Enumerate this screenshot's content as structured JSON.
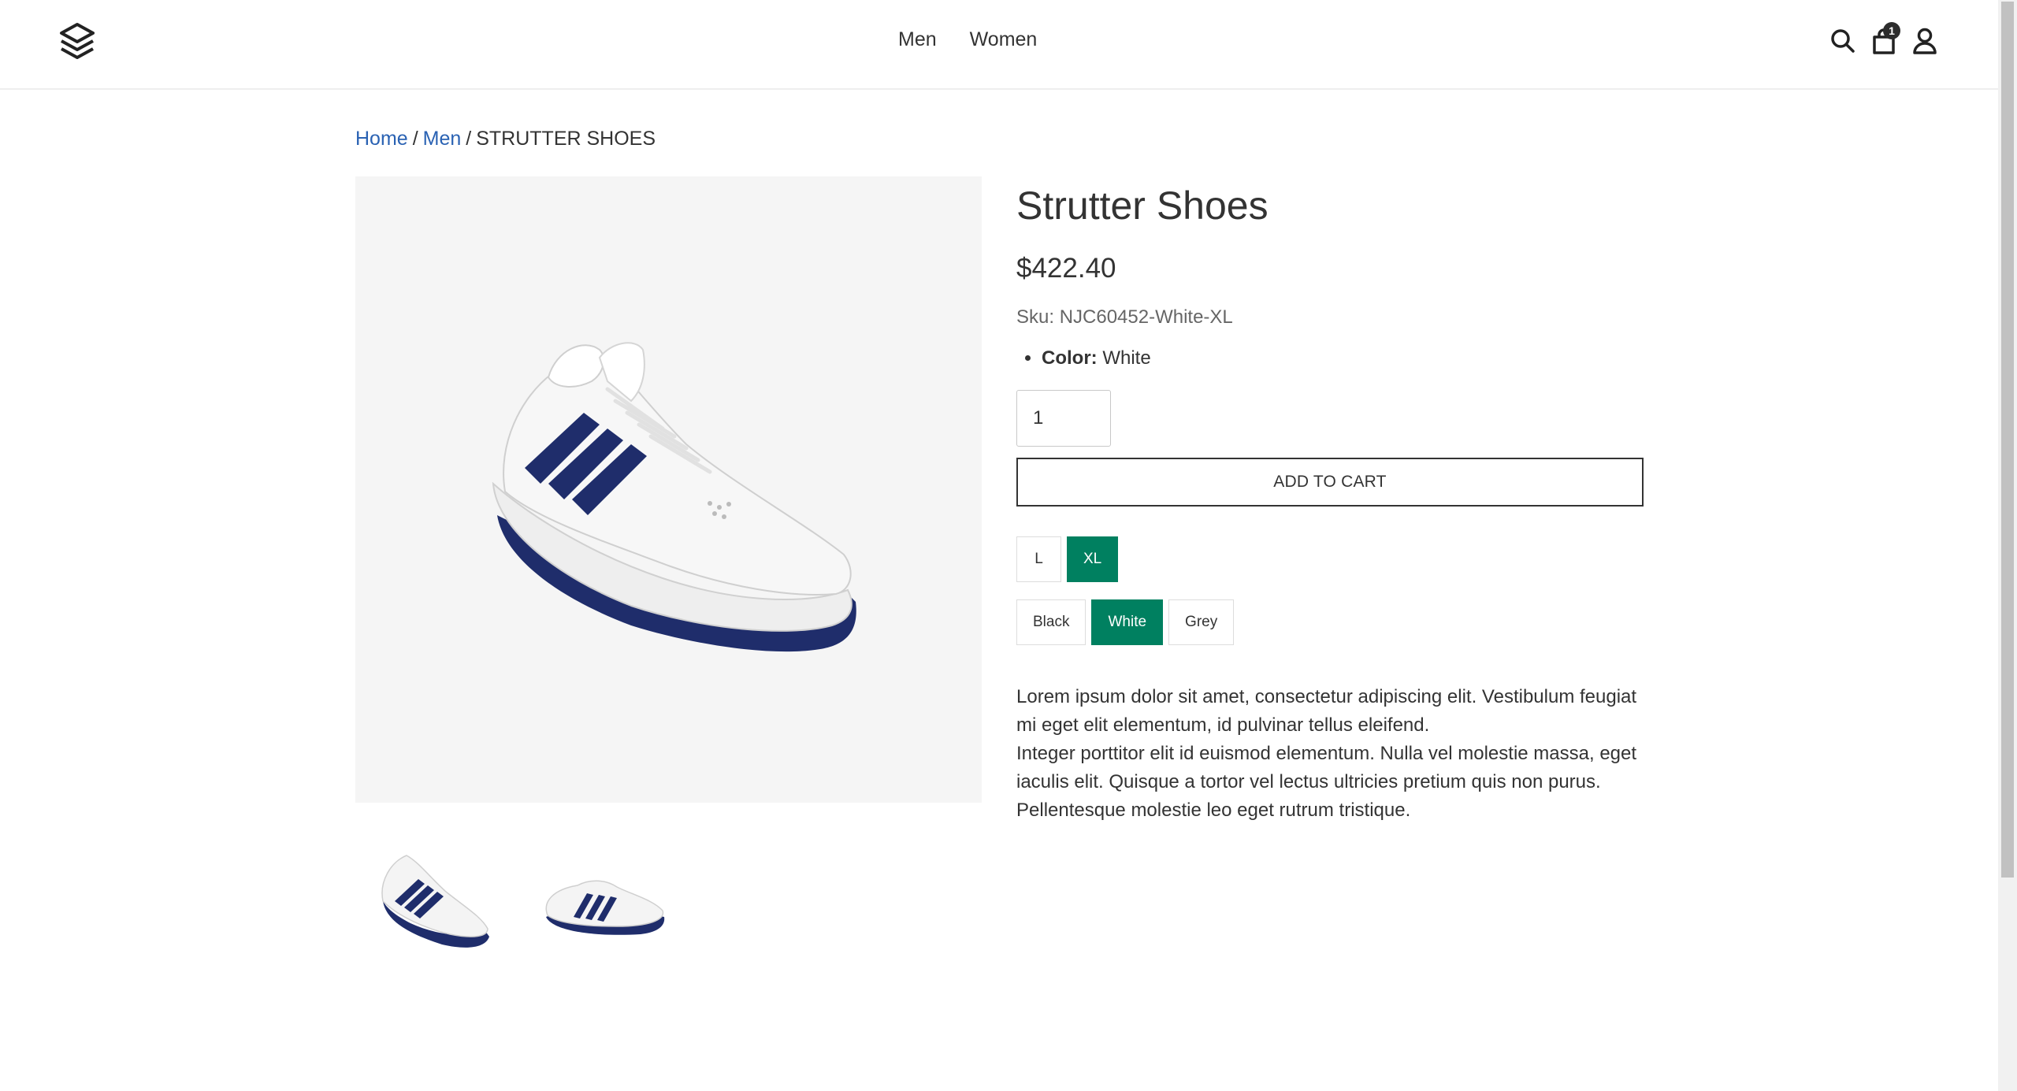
{
  "nav": {
    "items": [
      {
        "label": "Men"
      },
      {
        "label": "Women"
      }
    ]
  },
  "header": {
    "logo_icon": "layers-logo-icon",
    "icons": [
      "search-icon",
      "cart-icon",
      "user-icon"
    ],
    "cart_count": "1"
  },
  "breadcrumb": {
    "home": "Home",
    "sep": "/",
    "category": "Men",
    "current": "STRUTTER SHOES"
  },
  "product": {
    "title": "Strutter Shoes",
    "price": "$422.40",
    "sku": "Sku: NJC60452-White-XL",
    "attributes": [
      {
        "label": "Color:",
        "value": "White"
      }
    ],
    "quantity": "1",
    "add_to_cart": "ADD TO CART",
    "sizes": [
      {
        "label": "L",
        "selected": false
      },
      {
        "label": "XL",
        "selected": true
      }
    ],
    "colors": [
      {
        "label": "Black",
        "selected": false
      },
      {
        "label": "White",
        "selected": true
      },
      {
        "label": "Grey",
        "selected": false
      }
    ],
    "description": [
      "Lorem ipsum dolor sit amet, consectetur adipiscing elit. Vestibulum feugiat mi eget elit elementum, id pulvinar tellus eleifend.",
      "Integer porttitor elit id euismod elementum. Nulla vel molestie massa, eget iaculis elit. Quisque a tortor vel lectus ultricies pretium quis non purus. Pellentesque molestie leo eget rutrum tristique."
    ]
  },
  "colors": {
    "accent": "#008060",
    "link": "#2a62b3",
    "text": "#333333"
  }
}
